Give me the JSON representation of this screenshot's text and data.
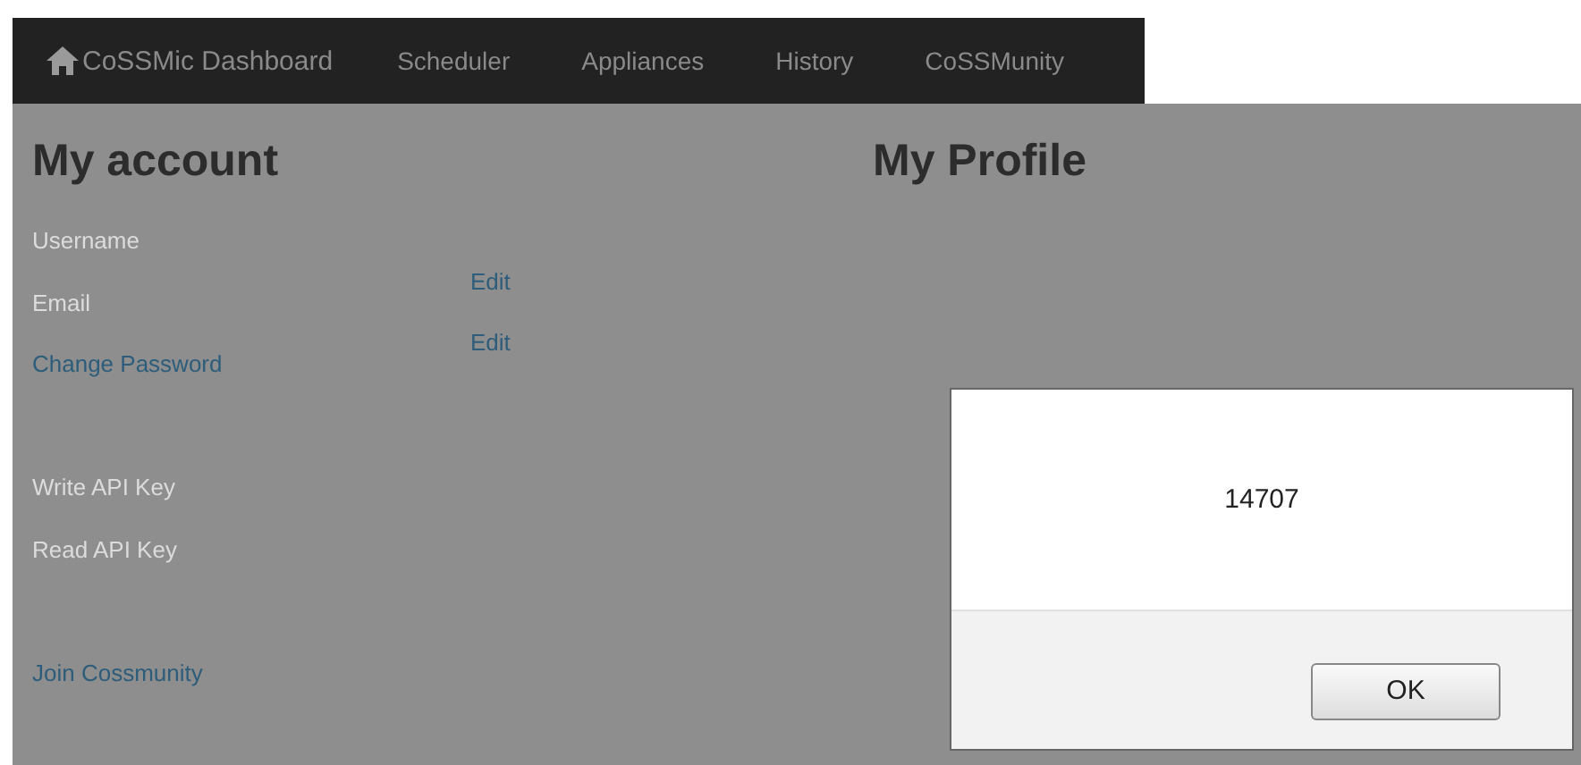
{
  "navbar": {
    "brand": "CoSSMic Dashboard",
    "items": [
      "Scheduler",
      "Appliances",
      "History",
      "CoSSMunity"
    ]
  },
  "account": {
    "title": "My account",
    "rows": [
      {
        "kind": "label",
        "text": "Username"
      },
      {
        "kind": "label",
        "text": "Email",
        "edit": "Edit"
      },
      {
        "kind": "link",
        "text": "Change Password",
        "edit": "Edit"
      },
      {
        "kind": "gap"
      },
      {
        "kind": "label",
        "text": "Write API Key"
      },
      {
        "kind": "label",
        "text": "Read API Key"
      },
      {
        "kind": "gap"
      },
      {
        "kind": "link",
        "text": "Join Cossmunity"
      }
    ]
  },
  "profile": {
    "title": "My Profile"
  },
  "dialog": {
    "message": "14707",
    "button": "OK"
  }
}
